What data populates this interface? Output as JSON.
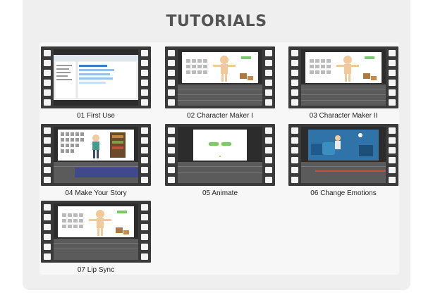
{
  "page": {
    "title": "TUTORIALS"
  },
  "tutorials": [
    {
      "label": "01 First Use"
    },
    {
      "label": "02 Character Maker I"
    },
    {
      "label": "03 Character Maker II"
    },
    {
      "label": "04 Make Your Story"
    },
    {
      "label": "05 Animate"
    },
    {
      "label": "06 Change Emotions"
    },
    {
      "label": "07 Lip Sync"
    }
  ],
  "colors": {
    "film": "#3a3a3a",
    "panel": "#efefef",
    "title": "#555555",
    "timeline": "#5b5b5b",
    "scene_blue": "#2f73a8",
    "button_green": "#7cc86a"
  }
}
